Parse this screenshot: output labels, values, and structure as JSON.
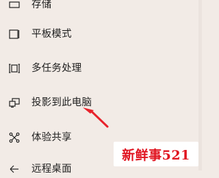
{
  "menu": {
    "items": [
      {
        "label": "存储",
        "icon": "storage-icon"
      },
      {
        "label": "平板模式",
        "icon": "tablet-mode-icon"
      },
      {
        "label": "多任务处理",
        "icon": "multitasking-icon"
      },
      {
        "label": "投影到此电脑",
        "icon": "project-to-pc-icon"
      },
      {
        "label": "体验共享",
        "icon": "shared-experiences-icon"
      },
      {
        "label": "远程桌面",
        "icon": "remote-desktop-icon"
      }
    ]
  },
  "annotation": {
    "arrow_color": "#e8222b"
  },
  "watermark": {
    "text": "新鲜事521",
    "color": "#e0131f"
  },
  "colors": {
    "background": "#f2ebe6",
    "text": "#1f1f1f"
  }
}
